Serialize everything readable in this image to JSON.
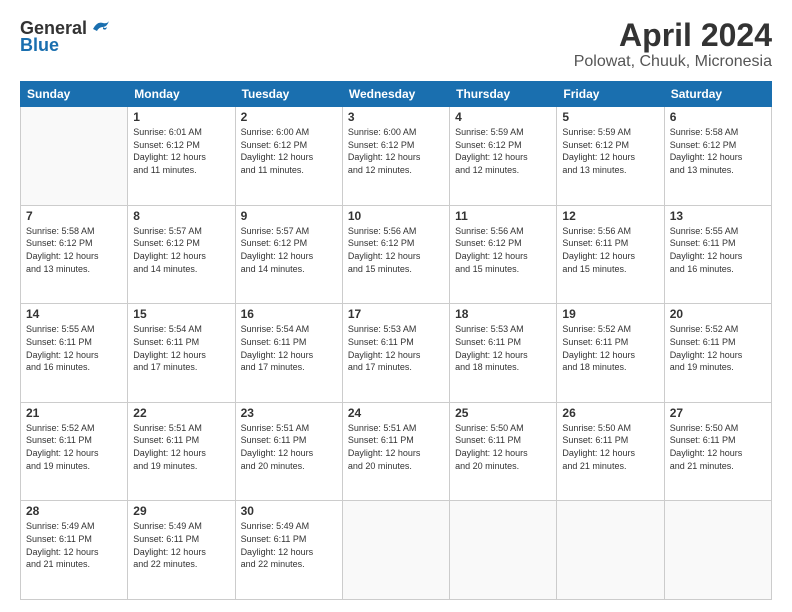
{
  "header": {
    "logo_line1": "General",
    "logo_line2": "Blue",
    "title": "April 2024",
    "subtitle": "Polowat, Chuuk, Micronesia"
  },
  "calendar": {
    "days_of_week": [
      "Sunday",
      "Monday",
      "Tuesday",
      "Wednesday",
      "Thursday",
      "Friday",
      "Saturday"
    ],
    "weeks": [
      [
        {
          "day": "",
          "info": ""
        },
        {
          "day": "1",
          "info": "Sunrise: 6:01 AM\nSunset: 6:12 PM\nDaylight: 12 hours\nand 11 minutes."
        },
        {
          "day": "2",
          "info": "Sunrise: 6:00 AM\nSunset: 6:12 PM\nDaylight: 12 hours\nand 11 minutes."
        },
        {
          "day": "3",
          "info": "Sunrise: 6:00 AM\nSunset: 6:12 PM\nDaylight: 12 hours\nand 12 minutes."
        },
        {
          "day": "4",
          "info": "Sunrise: 5:59 AM\nSunset: 6:12 PM\nDaylight: 12 hours\nand 12 minutes."
        },
        {
          "day": "5",
          "info": "Sunrise: 5:59 AM\nSunset: 6:12 PM\nDaylight: 12 hours\nand 13 minutes."
        },
        {
          "day": "6",
          "info": "Sunrise: 5:58 AM\nSunset: 6:12 PM\nDaylight: 12 hours\nand 13 minutes."
        }
      ],
      [
        {
          "day": "7",
          "info": "Sunrise: 5:58 AM\nSunset: 6:12 PM\nDaylight: 12 hours\nand 13 minutes."
        },
        {
          "day": "8",
          "info": "Sunrise: 5:57 AM\nSunset: 6:12 PM\nDaylight: 12 hours\nand 14 minutes."
        },
        {
          "day": "9",
          "info": "Sunrise: 5:57 AM\nSunset: 6:12 PM\nDaylight: 12 hours\nand 14 minutes."
        },
        {
          "day": "10",
          "info": "Sunrise: 5:56 AM\nSunset: 6:12 PM\nDaylight: 12 hours\nand 15 minutes."
        },
        {
          "day": "11",
          "info": "Sunrise: 5:56 AM\nSunset: 6:12 PM\nDaylight: 12 hours\nand 15 minutes."
        },
        {
          "day": "12",
          "info": "Sunrise: 5:56 AM\nSunset: 6:11 PM\nDaylight: 12 hours\nand 15 minutes."
        },
        {
          "day": "13",
          "info": "Sunrise: 5:55 AM\nSunset: 6:11 PM\nDaylight: 12 hours\nand 16 minutes."
        }
      ],
      [
        {
          "day": "14",
          "info": "Sunrise: 5:55 AM\nSunset: 6:11 PM\nDaylight: 12 hours\nand 16 minutes."
        },
        {
          "day": "15",
          "info": "Sunrise: 5:54 AM\nSunset: 6:11 PM\nDaylight: 12 hours\nand 17 minutes."
        },
        {
          "day": "16",
          "info": "Sunrise: 5:54 AM\nSunset: 6:11 PM\nDaylight: 12 hours\nand 17 minutes."
        },
        {
          "day": "17",
          "info": "Sunrise: 5:53 AM\nSunset: 6:11 PM\nDaylight: 12 hours\nand 17 minutes."
        },
        {
          "day": "18",
          "info": "Sunrise: 5:53 AM\nSunset: 6:11 PM\nDaylight: 12 hours\nand 18 minutes."
        },
        {
          "day": "19",
          "info": "Sunrise: 5:52 AM\nSunset: 6:11 PM\nDaylight: 12 hours\nand 18 minutes."
        },
        {
          "day": "20",
          "info": "Sunrise: 5:52 AM\nSunset: 6:11 PM\nDaylight: 12 hours\nand 19 minutes."
        }
      ],
      [
        {
          "day": "21",
          "info": "Sunrise: 5:52 AM\nSunset: 6:11 PM\nDaylight: 12 hours\nand 19 minutes."
        },
        {
          "day": "22",
          "info": "Sunrise: 5:51 AM\nSunset: 6:11 PM\nDaylight: 12 hours\nand 19 minutes."
        },
        {
          "day": "23",
          "info": "Sunrise: 5:51 AM\nSunset: 6:11 PM\nDaylight: 12 hours\nand 20 minutes."
        },
        {
          "day": "24",
          "info": "Sunrise: 5:51 AM\nSunset: 6:11 PM\nDaylight: 12 hours\nand 20 minutes."
        },
        {
          "day": "25",
          "info": "Sunrise: 5:50 AM\nSunset: 6:11 PM\nDaylight: 12 hours\nand 20 minutes."
        },
        {
          "day": "26",
          "info": "Sunrise: 5:50 AM\nSunset: 6:11 PM\nDaylight: 12 hours\nand 21 minutes."
        },
        {
          "day": "27",
          "info": "Sunrise: 5:50 AM\nSunset: 6:11 PM\nDaylight: 12 hours\nand 21 minutes."
        }
      ],
      [
        {
          "day": "28",
          "info": "Sunrise: 5:49 AM\nSunset: 6:11 PM\nDaylight: 12 hours\nand 21 minutes."
        },
        {
          "day": "29",
          "info": "Sunrise: 5:49 AM\nSunset: 6:11 PM\nDaylight: 12 hours\nand 22 minutes."
        },
        {
          "day": "30",
          "info": "Sunrise: 5:49 AM\nSunset: 6:11 PM\nDaylight: 12 hours\nand 22 minutes."
        },
        {
          "day": "",
          "info": ""
        },
        {
          "day": "",
          "info": ""
        },
        {
          "day": "",
          "info": ""
        },
        {
          "day": "",
          "info": ""
        }
      ]
    ]
  }
}
